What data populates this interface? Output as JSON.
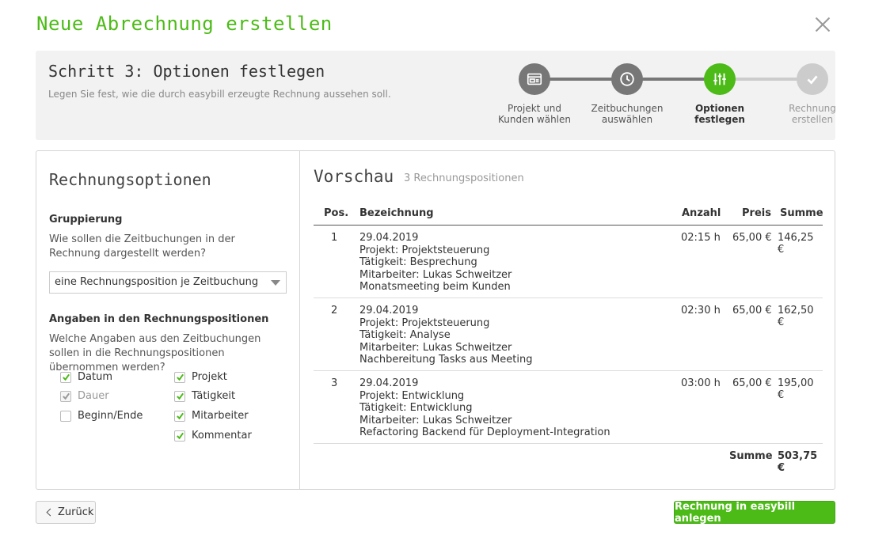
{
  "dialog": {
    "title": "Neue Abrechnung erstellen",
    "close_icon": "close-icon"
  },
  "step": {
    "title": "Schritt 3: Optionen festlegen",
    "subtitle": "Legen Sie fest, wie die durch easybill erzeugte Rechnung aussehen soll.",
    "items": [
      {
        "label": "Projekt und\nKunden wählen",
        "icon": "invoice-card-icon",
        "state": "done"
      },
      {
        "label": "Zeitbuchungen\nauswählen",
        "icon": "clock-icon",
        "state": "done"
      },
      {
        "label": "Optionen\nfestlegen",
        "icon": "sliders-icon",
        "state": "active"
      },
      {
        "label": "Rechnung\nerstellen",
        "icon": "check-icon",
        "state": "future"
      }
    ],
    "colors": {
      "done": "#777777",
      "active": "#4cbb17",
      "future": "#cccccc"
    }
  },
  "options": {
    "title": "Rechnungsoptionen",
    "grouping_label": "Gruppierung",
    "grouping_text": "Wie sollen die Zeitbuchungen in der Rechnung dargestellt werden?",
    "grouping_value": "eine Rechnungsposition je Zeitbuchung",
    "details_label": "Angaben in den Rechnungspositionen",
    "details_text": "Welche Angaben aus den Zeitbuchungen sollen in die Rechnungspositionen übernommen werden?",
    "checkboxes": [
      {
        "label": "Datum",
        "checked": true,
        "disabled": false
      },
      {
        "label": "Dauer",
        "checked": true,
        "disabled": true
      },
      {
        "label": "Beginn/Ende",
        "checked": false,
        "disabled": false
      },
      {
        "label": "Projekt",
        "checked": true,
        "disabled": false
      },
      {
        "label": "Tätigkeit",
        "checked": true,
        "disabled": false
      },
      {
        "label": "Mitarbeiter",
        "checked": true,
        "disabled": false
      },
      {
        "label": "Kommentar",
        "checked": true,
        "disabled": false
      }
    ]
  },
  "preview": {
    "title": "Vorschau",
    "count": "3 Rechnungspositionen",
    "headers": {
      "pos": "Pos.",
      "desc": "Bezeichnung",
      "qty": "Anzahl",
      "price": "Preis",
      "sum": "Summe"
    },
    "rows": [
      {
        "pos": "1",
        "lines": [
          "29.04.2019",
          "Projekt: Projektsteuerung",
          "Tätigkeit: Besprechung",
          "Mitarbeiter: Lukas Schweitzer",
          "Monatsmeeting beim Kunden"
        ],
        "qty": "02:15 h",
        "price": "65,00 €",
        "sum": "146,25 €"
      },
      {
        "pos": "2",
        "lines": [
          "29.04.2019",
          "Projekt: Projektsteuerung",
          "Tätigkeit: Analyse",
          "Mitarbeiter: Lukas Schweitzer",
          "Nachbereitung Tasks aus Meeting"
        ],
        "qty": "02:30 h",
        "price": "65,00 €",
        "sum": "162,50 €"
      },
      {
        "pos": "3",
        "lines": [
          "29.04.2019",
          "Projekt: Entwicklung",
          "Tätigkeit: Entwicklung",
          "Mitarbeiter: Lukas Schweitzer",
          "Refactoring Backend für Deployment-Integration"
        ],
        "qty": "03:00 h",
        "price": "65,00 €",
        "sum": "195,00 €"
      }
    ],
    "total_label": "Summe",
    "total_value": "503,75 €"
  },
  "footer": {
    "back_label": "Zurück",
    "create_label": "Rechnung in easybill anlegen"
  },
  "colors": {
    "accent": "#4cbb17"
  }
}
